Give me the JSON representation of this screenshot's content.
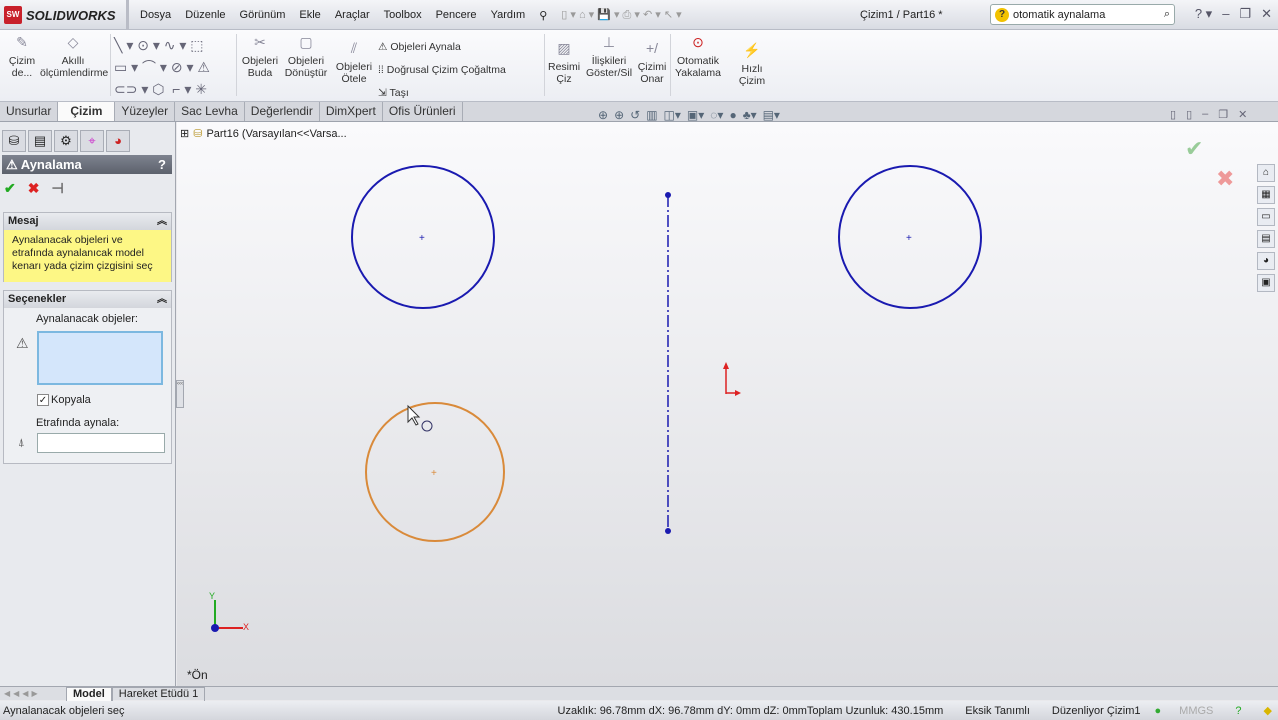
{
  "app": {
    "name": "SOLIDWORKS",
    "document_title": "Çizim1 / Part16 *"
  },
  "menu": [
    "Dosya",
    "Düzenle",
    "Görünüm",
    "Ekle",
    "Araçlar",
    "Toolbox",
    "Pencere",
    "Yardım"
  ],
  "search": {
    "value": "otomatik aynalama"
  },
  "ribbon": {
    "cizim": "Çizim de...",
    "akilli": "Akıllı ölçümlendirme",
    "buda": "Objeleri Buda",
    "donustur": "Objeleri Dönüştür",
    "otele": "Objeleri Ötele",
    "aynala": "Objeleri Aynala",
    "cogaltma": "Doğrusal Çizim Çoğaltma",
    "tasi": "Taşı",
    "resim": "Resimi Çiz",
    "iliskiler": "İlişkileri Göster/Sil",
    "onar": "Çizimi Onar",
    "yakalama": "Otomatik Yakalama",
    "hizli": "Hızlı Çizim"
  },
  "tabs": [
    "Unsurlar",
    "Çizim",
    "Yüzeyler",
    "Sac Levha",
    "Değerlendir",
    "DimXpert",
    "Ofis Ürünleri"
  ],
  "panel": {
    "title": "Aynalama",
    "help": "?",
    "message_header": "Mesaj",
    "message": "Aynalanacak objeleri ve etrafında aynalanıcak model kenarı yada çizim çizgisini seç",
    "options_header": "Seçenekler",
    "entities_label": "Aynalanacak objeler:",
    "copy_label": "Kopyala",
    "copy_checked": true,
    "mirror_about_label": "Etrafında aynala:"
  },
  "tree": {
    "label": "Part16  (Varsayılan<<Varsa..."
  },
  "viewport": {
    "view_label": "*Ön",
    "axis_x": "X",
    "axis_y": "Y"
  },
  "bottom_tabs": [
    "Model",
    "Hareket Etüdü 1"
  ],
  "status": {
    "hint": "Aynalanacak objeleri seç",
    "measure": "Uzaklık: 96.78mm   dX: 96.78mm  dY: 0mm  dZ: 0mmToplam Uzunluk: 430.15mm",
    "state": "Eksik Tanımlı",
    "editing": "Düzenliyor Çizim1",
    "units": "MMGS"
  },
  "colors": {
    "sketch": "#1a1ab0",
    "selected": "#d98a3a"
  }
}
